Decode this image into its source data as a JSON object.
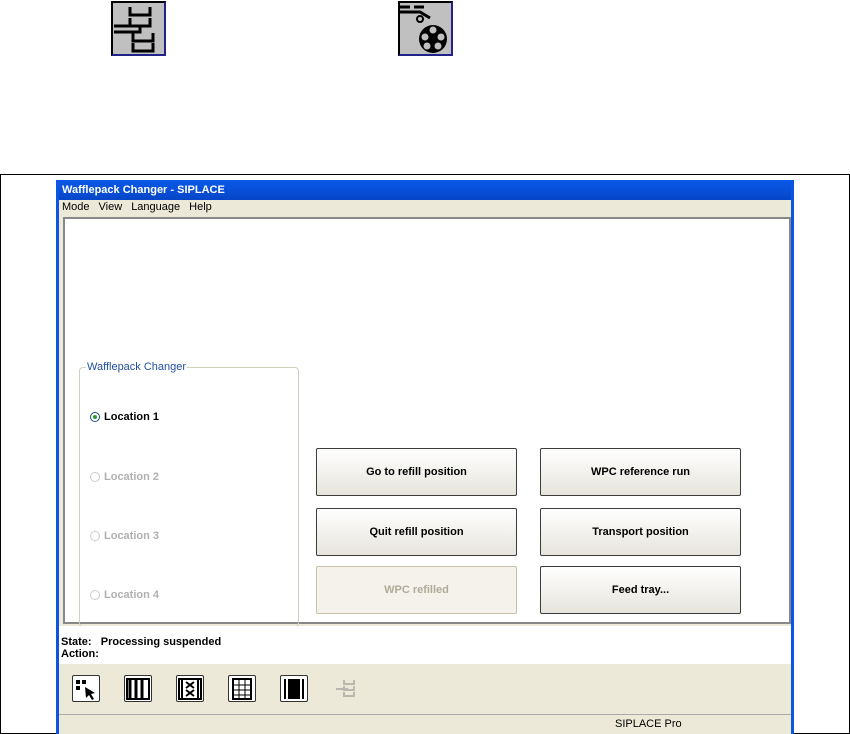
{
  "top_icons": [
    "tree-structure-icon",
    "reel-feeder-icon"
  ],
  "window": {
    "title": "Wafflepack Changer - SIPLACE"
  },
  "menu": [
    "Mode",
    "View",
    "Language",
    "Help"
  ],
  "group": {
    "label": "Wafflepack Changer",
    "locations": [
      {
        "label": "Location 1",
        "selected": true,
        "enabled": true
      },
      {
        "label": "Location 2",
        "selected": false,
        "enabled": false
      },
      {
        "label": "Location 3",
        "selected": false,
        "enabled": false
      },
      {
        "label": "Location 4",
        "selected": false,
        "enabled": false
      }
    ]
  },
  "buttons": {
    "go_refill": "Go to refill position",
    "wpc_ref": "WPC reference run",
    "quit_refill": "Quit refill position",
    "transport": "Transport position",
    "wpc_refilled": "WPC refilled",
    "feed_tray": "Feed tray..."
  },
  "status": {
    "state_label": "State:",
    "state_value": "Processing suspended",
    "action_label": "Action:",
    "action_value": ""
  },
  "toolbar": [
    "select-tray-icon",
    "magazine-icon",
    "magazine-empty-icon",
    "grid-tray-icon",
    "tape-icon",
    "tree-structure-icon"
  ],
  "statusbar": {
    "text": "SIPLACE Pro"
  }
}
